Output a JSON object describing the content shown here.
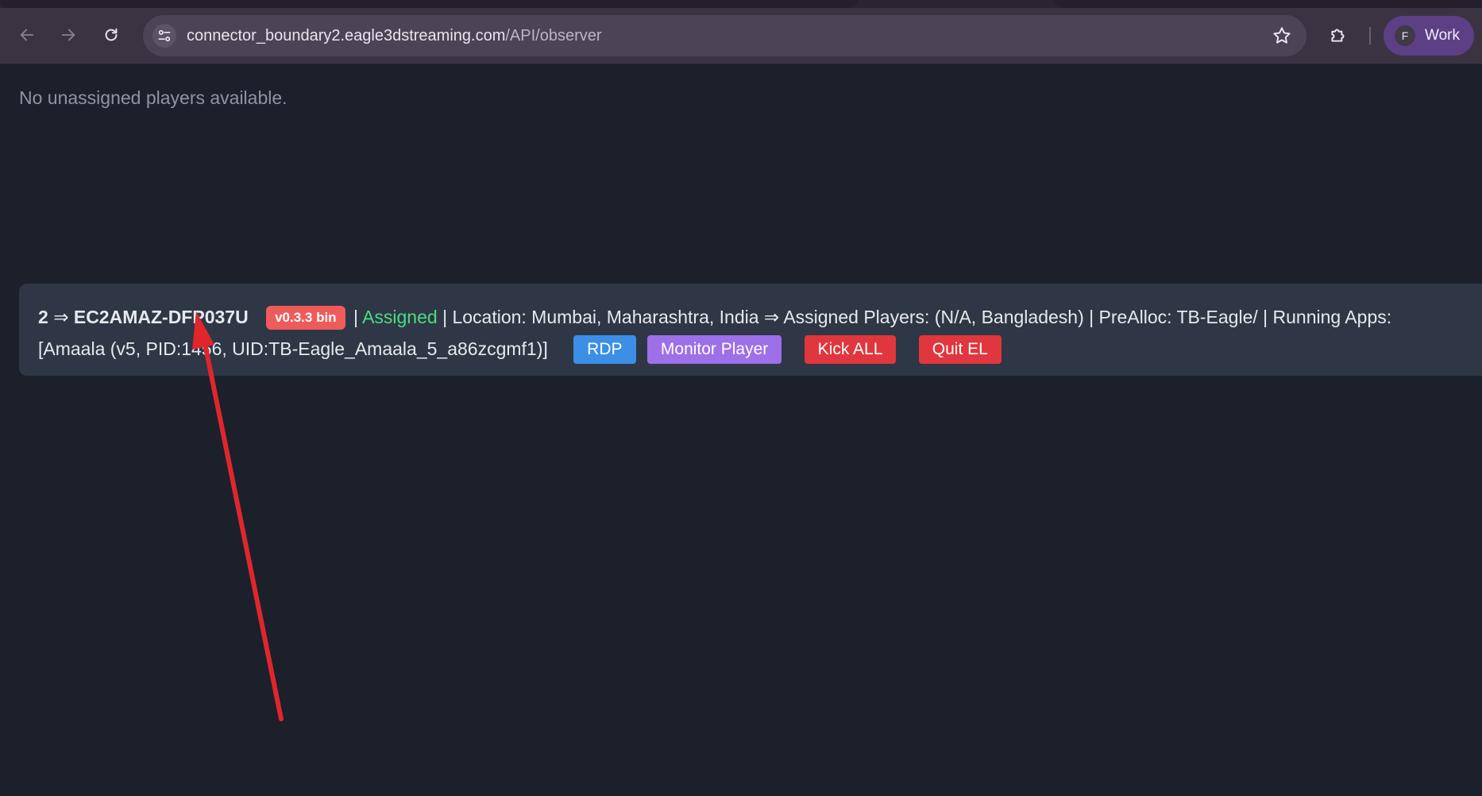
{
  "browser": {
    "url_host": "connector_boundary2.eagle3dstreaming.com",
    "url_path": "/API/observer",
    "profile_initial": "F",
    "profile_label": "Work"
  },
  "page": {
    "empty_message": "No unassigned players available."
  },
  "server": {
    "index": "2",
    "separator": "⇒",
    "hostname": "EC2AMAZ-DFP037U",
    "version_badge": "v0.3.3 bin",
    "pipe1": "|",
    "status": "Assigned",
    "details": "| Location: Mumbai, Maharashtra, India ⇒ Assigned Players: (N/A, Bangladesh) | PreAlloc: TB-Eagle/ | Running Apps:",
    "running_apps": "[Amaala (v5, PID:1456, UID:TB-Eagle_Amaala_5_a86zcgmf1)]",
    "buttons": {
      "rdp": "RDP",
      "monitor": "Monitor Player",
      "kick": "Kick ALL",
      "quit": "Quit EL"
    }
  },
  "colors": {
    "page_bg": "#1b202b",
    "card_bg": "#2f3746",
    "badge": "#ef5b5b",
    "assigned": "#4ade80",
    "rdp": "#3b8fe6",
    "monitor": "#9d6fe8",
    "danger": "#e0363d",
    "annotation_arrow": "#e0262b"
  }
}
